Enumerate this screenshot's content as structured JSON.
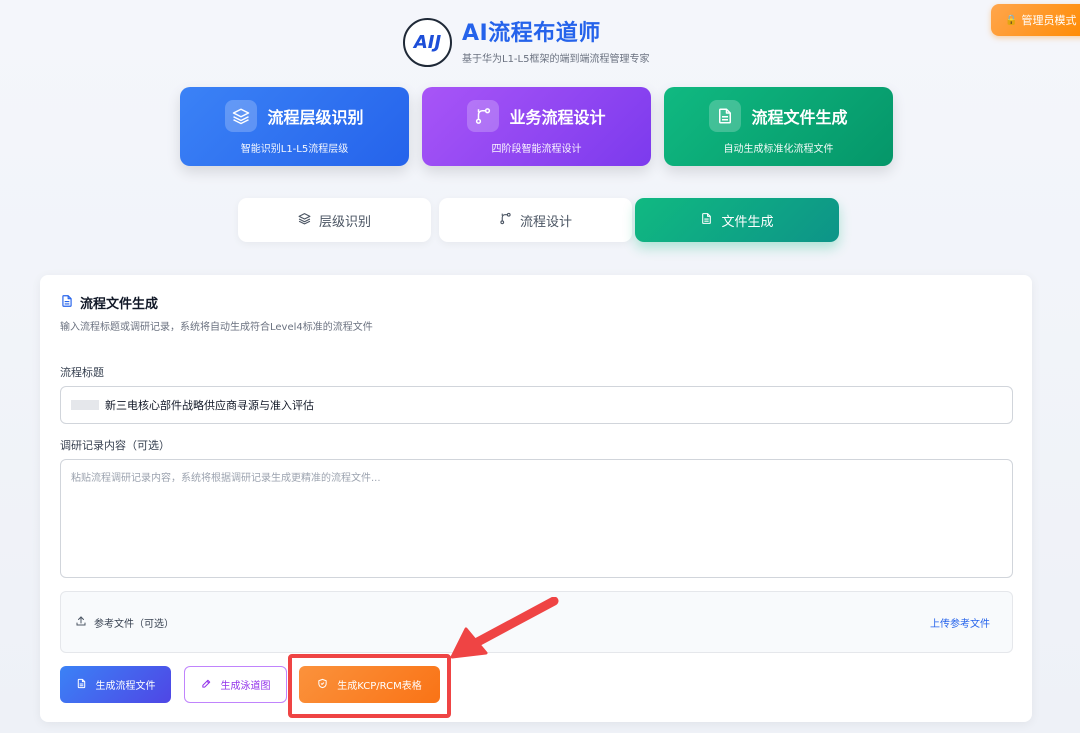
{
  "admin": {
    "label": "管理员模式",
    "icon": "admin-icon"
  },
  "header": {
    "logo_text": "AIJ",
    "title": "AI流程布道师",
    "subtitle": "基于华为L1-L5框架的端到端流程管理专家"
  },
  "feature_cards": [
    {
      "title": "流程层级识别",
      "desc": "智能识别L1-L5流程层级",
      "icon": "layers-icon",
      "color": "#2563eb"
    },
    {
      "title": "业务流程设计",
      "desc": "四阶段智能流程设计",
      "icon": "git-branch-icon",
      "color": "#7c3aed"
    },
    {
      "title": "流程文件生成",
      "desc": "自动生成标准化流程文件",
      "icon": "document-icon",
      "color": "#059669"
    }
  ],
  "tabs": [
    {
      "label": "层级识别",
      "icon": "layers-icon",
      "active": false
    },
    {
      "label": "流程设计",
      "icon": "git-branch-icon",
      "active": false
    },
    {
      "label": "文件生成",
      "icon": "document-icon",
      "active": true
    }
  ],
  "panel": {
    "title": "流程文件生成",
    "description": "输入流程标题或调研记录，系统将自动生成符合Level4标准的流程文件",
    "title_label": "流程标题",
    "title_value": "新三电核心部件战略供应商寻源与准入评估",
    "content_label": "调研记录内容（可选）",
    "content_placeholder": "粘贴流程调研记录内容，系统将根据调研记录生成更精准的流程文件...",
    "upload_label": "参考文件（可选）",
    "upload_link": "上传参考文件"
  },
  "actions": {
    "generate_doc": "生成流程文件",
    "generate_swimlane": "生成泳道图",
    "generate_kcp": "生成KCP/RCM表格"
  },
  "colors": {
    "accent_red": "#ef4444",
    "active_tab": "#10b981"
  }
}
